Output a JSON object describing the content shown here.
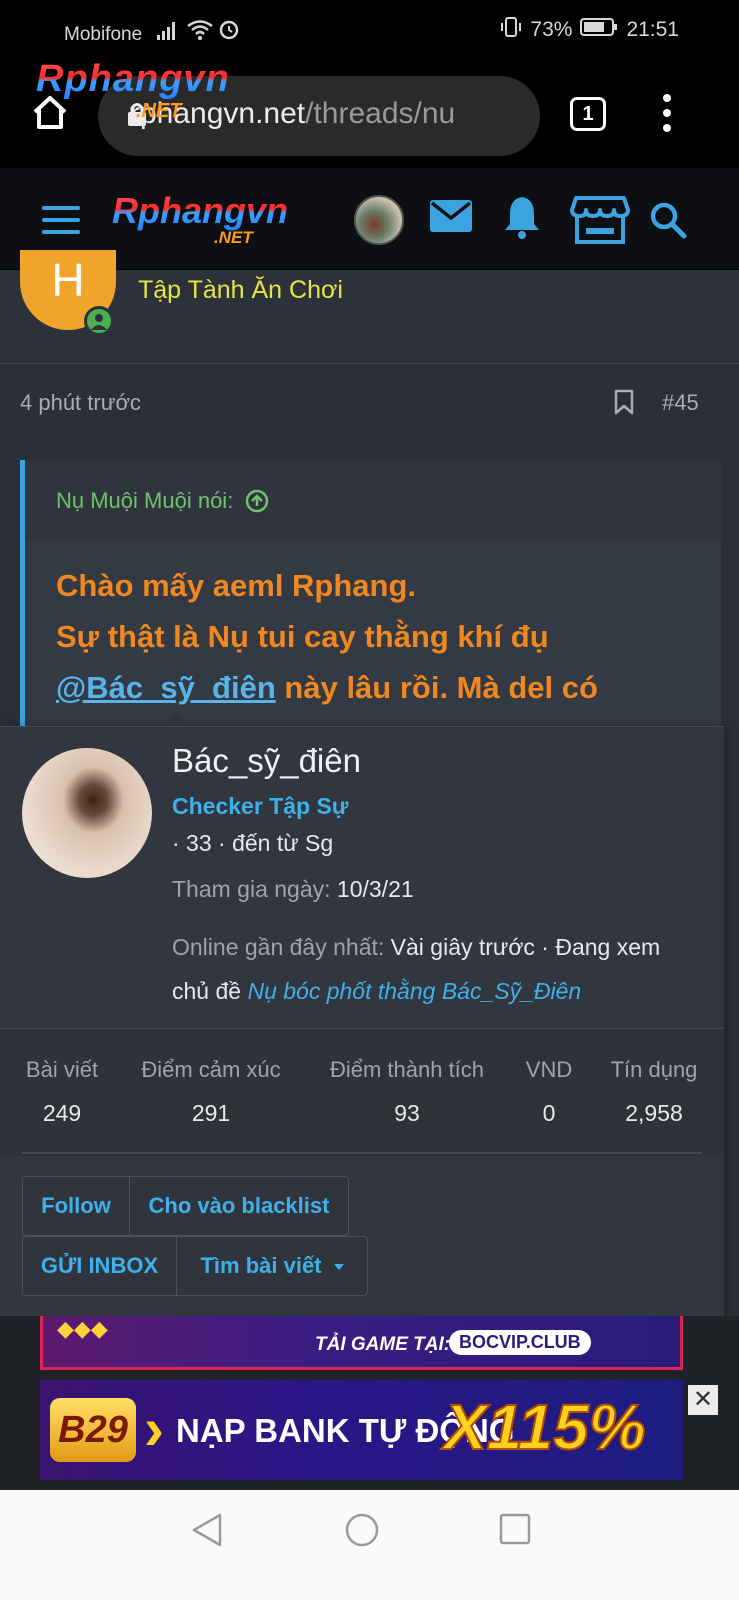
{
  "status_bar": {
    "carrier": "Mobifone",
    "battery": "73%",
    "time": "21:51"
  },
  "browser": {
    "logo": "Rphangvn",
    "logo_suffix": ".NET",
    "url_host": "rphangvn.net",
    "url_path": "/threads/nu",
    "tab_count": "1"
  },
  "site_nav": {
    "logo": "Rphangvn",
    "logo_suffix": ".NET",
    "accent": "#3ba3e0"
  },
  "post": {
    "avatar_letter": "H",
    "user_title": "Tập Tành Ăn Chơi",
    "time": "4 phút trước",
    "number": "#45",
    "quote": {
      "author": "Nụ Muội Muội nói:",
      "line1": "Chào mấy aeml Rphang.",
      "line2": "Sự thật là Nụ tui cay thằng khí đụ",
      "mention": "@Bác_sỹ_điên",
      "line3_rest": " này lâu rồi. Mà del có"
    }
  },
  "profile_tooltip": {
    "name": "Bác_sỹ_điên",
    "role": "Checker Tập Sự",
    "meta": "· 33 · đến từ Sg",
    "joined_label": "Tham gia ngày:",
    "joined_value": "10/3/21",
    "online_label": "Online gần đây nhất:",
    "online_value": "Vài giây trước · Đang xem chủ đề",
    "online_thread": "Nụ bóc phốt thằng Bác_Sỹ_Điên",
    "stats": [
      {
        "label": "Bài viết",
        "value": "249"
      },
      {
        "label": "Điểm cảm xúc",
        "value": "291"
      },
      {
        "label": "Điểm thành tích",
        "value": "93"
      },
      {
        "label": "VND",
        "value": "0"
      },
      {
        "label": "Tín dụng",
        "value": "2,958"
      }
    ],
    "buttons": {
      "follow": "Follow",
      "blacklist": "Cho vào blacklist",
      "inbox": "GỬI INBOX",
      "find_posts": "Tìm bài viết"
    }
  },
  "ads": {
    "ad1_text": "TẢI GAME TẠI:",
    "ad1_url": "BOCVIP.CLUB",
    "ad2_logo": "B29",
    "ad2_text": "NẠP BANK TỰ ĐỘNG",
    "ad2_promo": "X115%"
  }
}
